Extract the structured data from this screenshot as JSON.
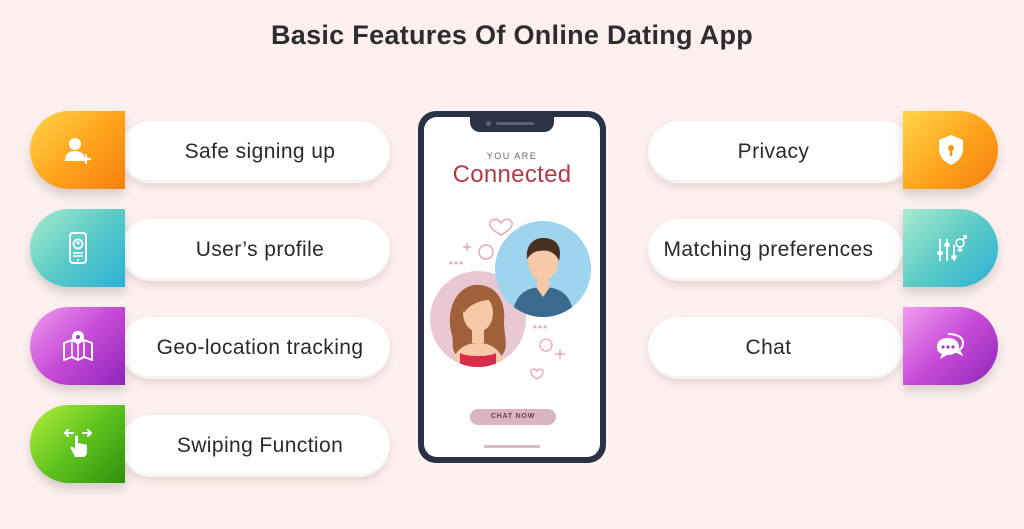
{
  "title": "Basic Features Of Online Dating App",
  "left_features": [
    {
      "label": "Safe signing up",
      "icon": "user-add-icon"
    },
    {
      "label": "User’s profile",
      "icon": "phone-profile-icon"
    },
    {
      "label": "Geo-location tracking",
      "icon": "map-pin-icon"
    },
    {
      "label": "Swiping Function",
      "icon": "swipe-hand-icon"
    }
  ],
  "right_features": [
    {
      "label": "Privacy",
      "icon": "shield-lock-icon"
    },
    {
      "label": "Matching preferences",
      "icon": "gender-sliders-icon"
    },
    {
      "label": "Chat",
      "icon": "chat-bubbles-icon"
    }
  ],
  "phone": {
    "small_text": "YOU ARE",
    "headline": "Connected",
    "button_label": "CHAT NOW"
  },
  "colors": {
    "background": "#fdf0ef",
    "headline": "#b43a4a",
    "phone_frame": "#2b3245"
  }
}
